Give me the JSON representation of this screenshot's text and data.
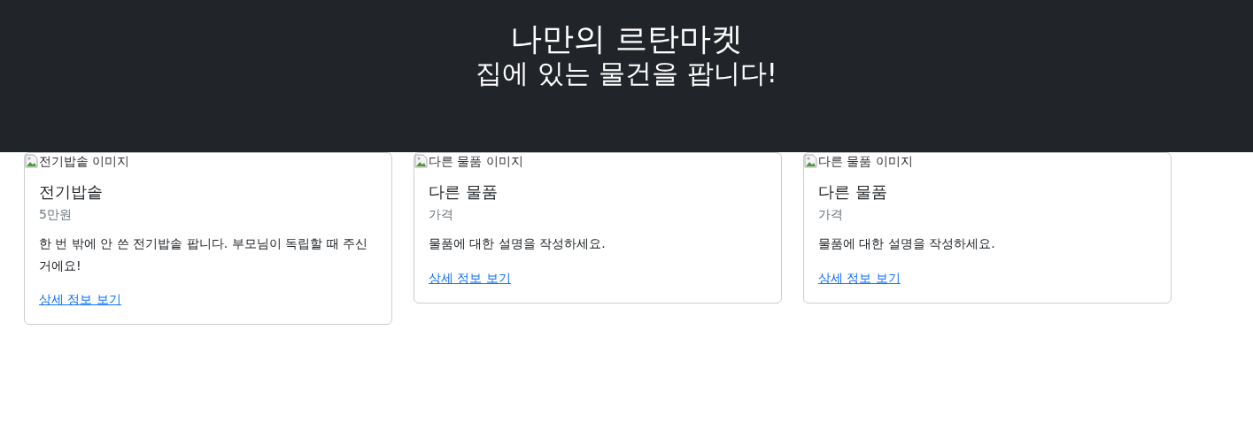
{
  "header": {
    "title": "나만의 르탄마켓",
    "subtitle": "집에 있는 물건을 팝니다!"
  },
  "cards": [
    {
      "image_alt": "전기밥솥 이미지",
      "title": "전기밥솥",
      "price": "5만원",
      "description": "한 번 밖에 안 쓴 전기밥솥 팝니다. 부모님이 독립할 때 주신 거에요!",
      "link": "상세 정보 보기"
    },
    {
      "image_alt": "다른 물품 이미지",
      "title": "다른 물품",
      "price": "가격",
      "description": "물품에 대한 설명을 작성하세요.",
      "link": "상세 정보 보기"
    },
    {
      "image_alt": "다른 물품 이미지",
      "title": "다른 물품",
      "price": "가격",
      "description": "물품에 대한 설명을 작성하세요.",
      "link": "상세 정보 보기"
    }
  ]
}
